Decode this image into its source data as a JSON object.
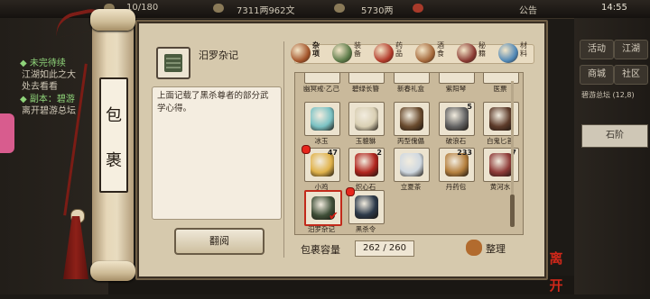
{
  "hud": {
    "resource1": "10/180",
    "resource2": "7311两962文",
    "resource3": "5730两",
    "announcement": "公告",
    "time": "14:55"
  },
  "left_panel": {
    "line1": "◆ 未完待续",
    "line2": "江湖如此之大",
    "line3": "处去看看",
    "line4": "◆ 副本：碧游",
    "line5": "离开碧游总坛"
  },
  "right_panel": {
    "btn1": "活动",
    "btn2": "江湖",
    "btn3": "商城",
    "btn4": "社区",
    "small_text": "碧游总坛 (12,8)",
    "item": "石阶"
  },
  "scroll": {
    "spine_char1": "包",
    "spine_char2": "裹"
  },
  "detail": {
    "title": "汨罗杂记",
    "description": "上面记载了黑杀尊者的部分武学心得。",
    "read_button": "翻阅"
  },
  "tabs": [
    {
      "label": "杂项",
      "color": "#a4552b",
      "active": true
    },
    {
      "label": "装备",
      "color": "#5b7a48",
      "active": false
    },
    {
      "label": "药品",
      "color": "#b23a2a",
      "active": false
    },
    {
      "label": "酒食",
      "color": "#a4683a",
      "active": false
    },
    {
      "label": "秘籍",
      "color": "#8a3a33",
      "active": false
    },
    {
      "label": "材料",
      "color": "#4f87b6",
      "active": false
    }
  ],
  "inventory": {
    "top_row_names": [
      "幽冥戒·乙己",
      "碧绿长簪",
      "新春礼盒",
      "紫阳琴",
      "医票"
    ],
    "rows": [
      [
        {
          "name": "冰玉",
          "count": "",
          "color": "#7bc2c4",
          "dot": false
        },
        {
          "name": "玉貔貅",
          "count": "",
          "color": "#d9cfb3",
          "dot": false
        },
        {
          "name": "丙型傀儡",
          "count": "",
          "color": "#6a4b2e",
          "dot": false
        },
        {
          "name": "破浪石",
          "count": "5",
          "color": "#646464",
          "dot": false
        },
        {
          "name": "白鬼匕首",
          "count": "",
          "color": "#5d3b2a",
          "dot": false
        }
      ],
      [
        {
          "name": "小鸡",
          "count": "47",
          "color": "#e0b24a",
          "dot": true
        },
        {
          "name": "炽心石",
          "count": "2",
          "color": "#b1261e",
          "dot": false
        },
        {
          "name": "立夏茶",
          "count": "",
          "color": "#cfd8e0",
          "dot": false
        },
        {
          "name": "丹药包",
          "count": "233",
          "color": "#b5803e",
          "dot": false
        },
        {
          "name": "黄河水",
          "count": "7",
          "color": "#8e3b38",
          "dot": false
        }
      ],
      [
        {
          "name": "汨罗杂记",
          "count": "",
          "color": "#3f4f38",
          "dot": false,
          "selected": true
        },
        {
          "name": "黑杀令",
          "count": "",
          "color": "#2d3a4a",
          "dot": true
        }
      ]
    ]
  },
  "capacity": {
    "label": "包裹容量",
    "value": "262 / 260"
  },
  "sort_button": "整理",
  "close_label": "离开"
}
